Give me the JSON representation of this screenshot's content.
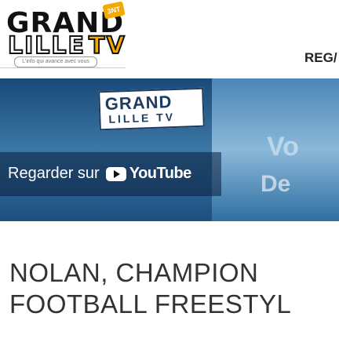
{
  "header": {
    "logo_top": "GRAND",
    "logo_bottom": "LILLE",
    "logo_tv": "TV",
    "logo_badge": "3NT",
    "logo_tagline": "L'info qui avance avec vous",
    "right_label": "REG/"
  },
  "video": {
    "watch_label": "Regarder sur",
    "youtube_word": "YouTube",
    "thumb_logo_top": "GRAND",
    "thumb_logo_bottom": "LILLE TV",
    "bg_text_1": "Vo",
    "bg_text_2": "De"
  },
  "article": {
    "title_line1": "NOLAN, CHAMPION",
    "title_line2": "FOOTBALL FREESTYL"
  },
  "colors": {
    "accent": "#f2a900",
    "title": "#333333"
  }
}
